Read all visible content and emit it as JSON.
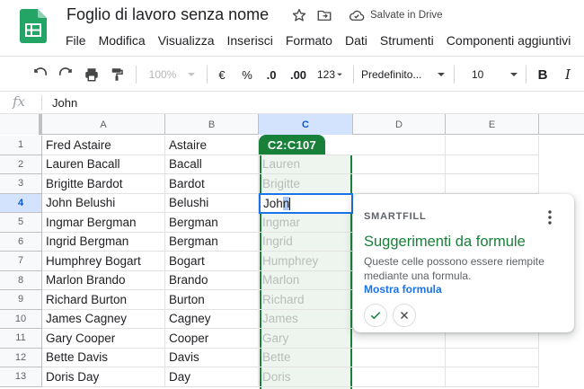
{
  "app": {
    "title": "Foglio di lavoro senza nome",
    "saved_status": "Salvate in Drive",
    "icons": [
      "sheets-logo-icon",
      "star-icon",
      "move-folder-icon",
      "cloud-done-icon"
    ]
  },
  "menu": [
    "File",
    "Modifica",
    "Visualizza",
    "Inserisci",
    "Formato",
    "Dati",
    "Strumenti",
    "Componenti aggiuntivi"
  ],
  "toolbar": {
    "zoom": "100%",
    "currency": "€",
    "percent": "%",
    "dec_decrease": ".0",
    "dec_increase": ".00",
    "more_formats": "123",
    "font": "Predefinito...",
    "font_size": "10",
    "bold": "B",
    "italic": "I"
  },
  "formula_bar": {
    "fx": "fx",
    "value": "John"
  },
  "sheet": {
    "columns": [
      "A",
      "B",
      "C",
      "D",
      "E"
    ],
    "rows": [
      {
        "n": "1",
        "a": "Fred Astaire",
        "b": "Astaire",
        "c": ""
      },
      {
        "n": "2",
        "a": "Lauren Bacall",
        "b": "Bacall",
        "c": "Lauren"
      },
      {
        "n": "3",
        "a": "Brigitte Bardot",
        "b": "Bardot",
        "c": "Brigitte"
      },
      {
        "n": "4",
        "a": "John Belushi",
        "b": "Belushi",
        "c": ""
      },
      {
        "n": "5",
        "a": "Ingmar Bergman",
        "b": "Bergman",
        "c": "Ingmar"
      },
      {
        "n": "6",
        "a": "Ingrid Bergman",
        "b": "Bergman",
        "c": "Ingrid"
      },
      {
        "n": "7",
        "a": "Humphrey Bogart",
        "b": "Bogart",
        "c": "Humphrey"
      },
      {
        "n": "8",
        "a": "Marlon Brando",
        "b": "Brando",
        "c": "Marlon"
      },
      {
        "n": "9",
        "a": "Richard Burton",
        "b": "Burton",
        "c": "Richard"
      },
      {
        "n": "10",
        "a": "James Cagney",
        "b": "Cagney",
        "c": "James"
      },
      {
        "n": "11",
        "a": "Gary Cooper",
        "b": "Cooper",
        "c": "Gary"
      },
      {
        "n": "12",
        "a": "Bette Davis",
        "b": "Davis",
        "c": "Bette"
      },
      {
        "n": "13",
        "a": "Doris Day",
        "b": "Day",
        "c": "Doris"
      }
    ],
    "active_cell": {
      "typed": "Joh",
      "suggested": "n"
    },
    "range_label": "C2:C107",
    "colors": {
      "range": "#188038",
      "range_fill": "#edf5ee",
      "active_border": "#1a73e8"
    }
  },
  "smartfill": {
    "label": "SMARTFILL",
    "title": "Suggerimenti da formule",
    "description": "Queste celle possono essere riempite mediante una formula.",
    "link": "Mostra formula",
    "accent": "#188038"
  }
}
